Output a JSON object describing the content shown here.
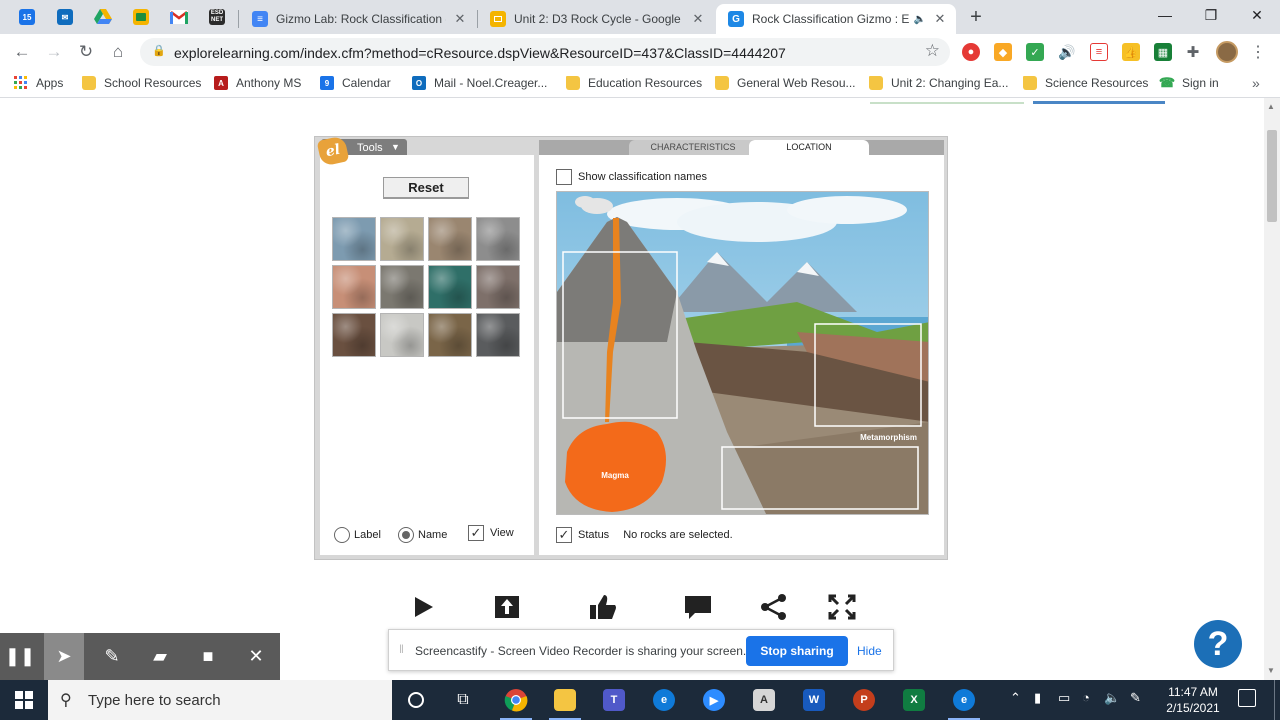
{
  "tabs": {
    "pinned": [
      {
        "icon": "calendar-icon",
        "text": "15",
        "color": "#1a73e8"
      },
      {
        "icon": "outlook-icon",
        "text": "",
        "color": "#0f6cbd"
      },
      {
        "icon": "google-drive-icon",
        "text": "",
        "color": "#1fa463"
      },
      {
        "icon": "google-classroom-icon",
        "text": "",
        "color": "#f5b400"
      },
      {
        "icon": "gmail-icon",
        "text": "M",
        "color": "#d93025"
      },
      {
        "icon": "esd-icon",
        "text": "ESD NET",
        "color": "#2b2b2b"
      }
    ],
    "items": [
      {
        "title": "Gizmo Lab: Rock Classification - (",
        "favicon": "google-docs-icon",
        "color": "#4285f4"
      },
      {
        "title": "Unit 2: D3 Rock Cycle - Google Sl",
        "favicon": "google-slides-icon",
        "color": "#f4b400"
      },
      {
        "title": "Rock Classification Gizmo : E",
        "favicon": "explorelearning-icon",
        "color": "#1e88e5",
        "letter": "G"
      }
    ],
    "new_tab": "+"
  },
  "window": {
    "minimize": "—",
    "maximize": "❐",
    "close": "✕"
  },
  "toolbar": {
    "back": "←",
    "forward": "→",
    "reload": "↻",
    "home": "⌂",
    "url": "explorelearning.com/index.cfm?method=cResource.dspView&ResourceID=437&ClassID=4444207",
    "star": "☆",
    "menu": "⋮"
  },
  "bookmarks": [
    {
      "label": "Apps",
      "icon": "apps-grid-icon"
    },
    {
      "label": "School Resources",
      "icon": "folder-icon"
    },
    {
      "label": "Anthony MS",
      "icon": "anthony-ms-icon"
    },
    {
      "label": "Calendar",
      "icon": "calendar-icon"
    },
    {
      "label": "Mail - Noel.Creager...",
      "icon": "outlook-icon"
    },
    {
      "label": "Education Resources",
      "icon": "folder-icon"
    },
    {
      "label": "General Web Resou...",
      "icon": "folder-icon"
    },
    {
      "label": "Unit 2: Changing Ea...",
      "icon": "folder-icon"
    },
    {
      "label": "Science Resources",
      "icon": "folder-icon"
    },
    {
      "label": "Sign in",
      "icon": "phone-icon"
    }
  ],
  "bookmarks_more": "»",
  "gizmo": {
    "tools_label": "Tools",
    "logo_text": "el",
    "tab_characteristics": "CHARACTERISTICS",
    "tab_location": "LOCATION",
    "reset_label": "Reset",
    "radio_label": "Label",
    "radio_name": "Name",
    "view_label": "View",
    "show_names_label": "Show classification names",
    "status_label": "Status",
    "status_message": "No rocks are selected.",
    "scene_magma": "Magma",
    "scene_metamorphism": "Metamorphism",
    "label_selected": false,
    "name_selected": true,
    "view_checked": true,
    "show_names_checked": false,
    "status_checked": true
  },
  "rocks": [
    {
      "name": "rock-sample-1",
      "color": "#7d9bb0"
    },
    {
      "name": "rock-sample-2",
      "color": "#b5ab92"
    },
    {
      "name": "rock-sample-3",
      "color": "#9a8670"
    },
    {
      "name": "rock-sample-4",
      "color": "#8d8d8d"
    },
    {
      "name": "rock-sample-5",
      "color": "#c78f77"
    },
    {
      "name": "rock-sample-6",
      "color": "#7b7870"
    },
    {
      "name": "rock-sample-7",
      "color": "#2f6f68"
    },
    {
      "name": "rock-sample-8",
      "color": "#7e706a"
    },
    {
      "name": "rock-sample-9",
      "color": "#6a5040"
    },
    {
      "name": "rock-sample-10",
      "color": "#c8c8c4"
    },
    {
      "name": "rock-sample-11",
      "color": "#7a6548"
    },
    {
      "name": "rock-sample-12",
      "color": "#5a5c5e"
    }
  ],
  "controls": [
    "play-icon",
    "upload-icon",
    "thumbs-up-icon",
    "comment-icon",
    "share-icon",
    "fullscreen-icon"
  ],
  "help": "?",
  "screencastify": {
    "message": "Screencastify - Screen Video Recorder is sharing your screen.",
    "stop_label": "Stop sharing",
    "hide_label": "Hide"
  },
  "draw_toolbar": [
    "pause-icon",
    "cursor-icon",
    "pen-icon",
    "highlighter-icon",
    "camera-icon",
    "close-icon"
  ],
  "taskbar": {
    "search_placeholder": "Type here to search",
    "time": "11:47 AM",
    "date": "2/15/2021"
  },
  "colors": {
    "accent": "#1a73e8",
    "magma": "#f36a1a",
    "lava": "#e8831f",
    "help": "#1c6fb7"
  }
}
